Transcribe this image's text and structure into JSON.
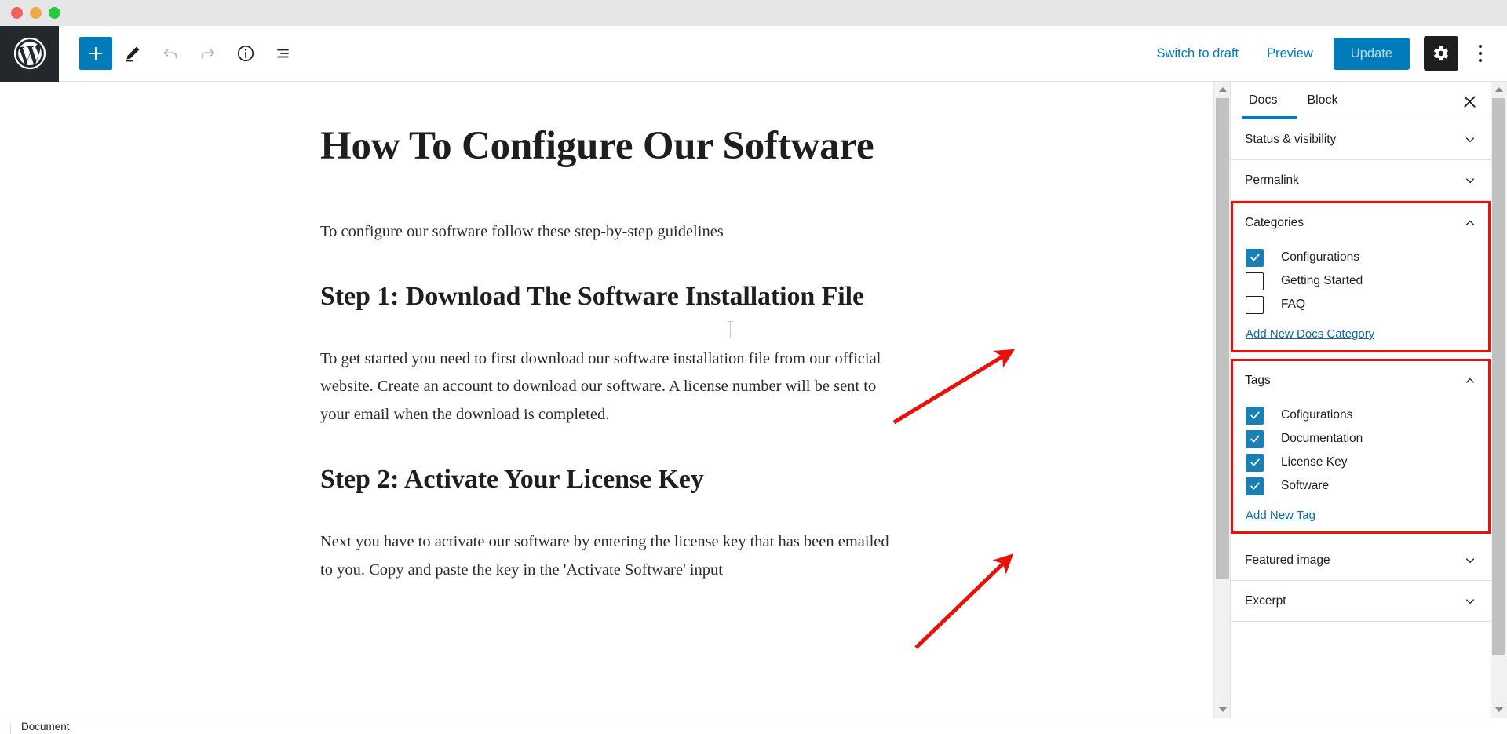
{
  "window": {
    "traffic_lights": [
      "close",
      "minimize",
      "zoom"
    ]
  },
  "toolbar": {
    "logo": "wordpress-logo",
    "add_block_label": "+",
    "tools": [
      {
        "name": "add-block-button",
        "icon": "plus-icon"
      },
      {
        "name": "edit-tool-button",
        "icon": "pencil-icon"
      },
      {
        "name": "undo-button",
        "icon": "undo-arrow-icon"
      },
      {
        "name": "redo-button",
        "icon": "redo-arrow-icon"
      },
      {
        "name": "details-button",
        "icon": "info-circle-icon"
      },
      {
        "name": "list-view-button",
        "icon": "list-view-icon"
      }
    ],
    "switch_to_draft": "Switch to draft",
    "preview": "Preview",
    "update": "Update",
    "settings_icon": "gear-icon",
    "more_options_icon": "kebab-menu-icon"
  },
  "post": {
    "title": "How To Configure Our Software",
    "intro": "To configure our software follow these step-by-step guidelines",
    "step1_heading": "Step 1: Download The Software Installation File",
    "step1_body": "To get started you need to first download our software installation file from our official website. Create an account to download our software. A license number will be sent to your email when the download is completed.",
    "step2_heading": "Step 2: Activate Your License Key",
    "step2_body": "Next you have to activate our software by entering the license key that has been emailed to you. Copy and paste the key in the 'Activate Software' input"
  },
  "sidebar": {
    "tabs": [
      {
        "label": "Docs",
        "active": true
      },
      {
        "label": "Block",
        "active": false
      }
    ],
    "close_icon": "close-x-icon",
    "panels_top": [
      {
        "label": "Status & visibility",
        "expanded": false,
        "chevron": "chevron-down-icon"
      },
      {
        "label": "Permalink",
        "expanded": false,
        "chevron": "chevron-down-icon"
      }
    ],
    "categories": {
      "label": "Categories",
      "expanded": true,
      "chevron": "chevron-up-icon",
      "highlighted": true,
      "items": [
        {
          "label": "Configurations",
          "checked": true
        },
        {
          "label": "Getting Started",
          "checked": false
        },
        {
          "label": "FAQ",
          "checked": false
        }
      ],
      "add_link": "Add New Docs Category"
    },
    "tags": {
      "label": "Tags",
      "expanded": true,
      "chevron": "chevron-up-icon",
      "highlighted": true,
      "items": [
        {
          "label": "Cofigurations",
          "checked": true
        },
        {
          "label": "Documentation",
          "checked": true
        },
        {
          "label": "License Key",
          "checked": true
        },
        {
          "label": "Software",
          "checked": true
        }
      ],
      "add_link": "Add New Tag"
    },
    "panels_bottom": [
      {
        "label": "Featured image",
        "expanded": false,
        "chevron": "chevron-down-icon"
      },
      {
        "label": "Excerpt",
        "expanded": false,
        "chevron": "chevron-down-icon"
      }
    ]
  },
  "footer": {
    "breadcrumb": "Document"
  },
  "annotations": {
    "arrow_color": "#e8120b",
    "highlight_color": "#e8120b",
    "arrows": [
      {
        "name": "arrow-to-categories",
        "from": [
          1139,
          438
        ],
        "to": [
          1287,
          368
        ]
      },
      {
        "name": "arrow-to-tags",
        "from": [
          1166,
          686
        ],
        "to": [
          1283,
          593
        ]
      }
    ]
  },
  "colors": {
    "accent_blue": "#007cba",
    "checkbox_blue": "#1a7fb3",
    "link_blue": "#0b6aa2",
    "dark": "#1e1e1e",
    "logo_bg": "#23282d",
    "titlebar_bg": "#e6e6e6"
  }
}
